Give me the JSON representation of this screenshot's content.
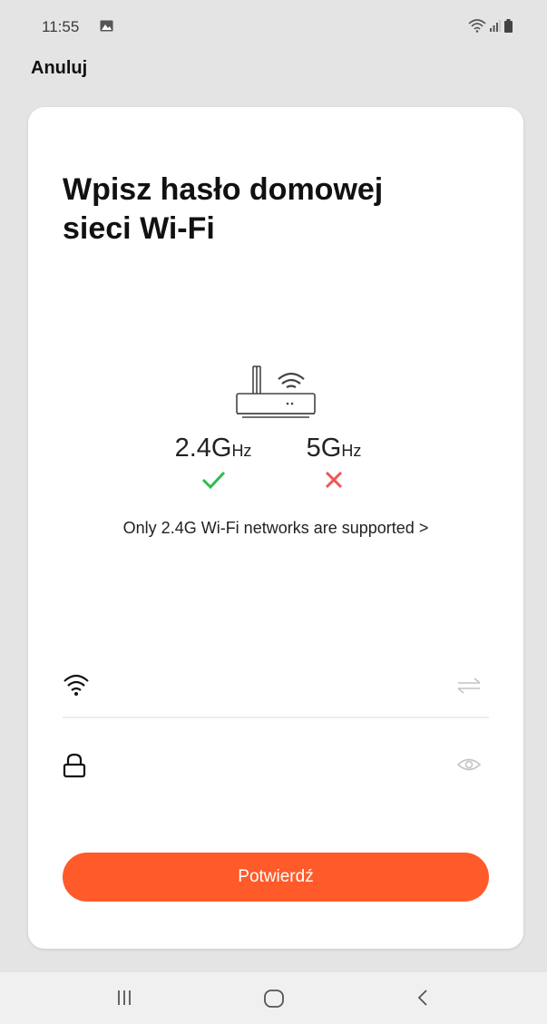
{
  "status_bar": {
    "time": "11:55",
    "icons": [
      "gallery-icon",
      "wifi-icon",
      "signal-icon",
      "battery-icon"
    ]
  },
  "header": {
    "cancel_label": "Anuluj"
  },
  "card": {
    "title_line1": "Wpisz hasło domowej",
    "title_line2": "sieci Wi-Fi",
    "illustration_icon": "router-icon",
    "bands": [
      {
        "label": "2.4G",
        "unit": "Hz",
        "supported": true,
        "mark_icon": "check-icon",
        "mark_color": "#2bbd4c"
      },
      {
        "label": "5G",
        "unit": "Hz",
        "supported": false,
        "mark_icon": "cross-icon",
        "mark_color": "#f05454"
      }
    ],
    "supported_note": "Only 2.4G Wi-Fi networks are supported",
    "supported_chevron": ">",
    "wifi_field": {
      "value": "",
      "placeholder": "",
      "icon": "wifi-icon",
      "action_icon": "switch-network-icon"
    },
    "password_field": {
      "value": "",
      "placeholder": "",
      "icon": "lock-icon",
      "action_icon": "eye-icon"
    },
    "confirm_label": "Potwierdź"
  },
  "nav_bar": {
    "buttons": [
      "recent-apps-icon",
      "home-icon",
      "back-icon"
    ]
  },
  "colors": {
    "accent": "#ff5a2a",
    "background": "#e4e4e4",
    "card": "#ffffff",
    "success": "#2bbd4c",
    "error": "#f05454"
  }
}
